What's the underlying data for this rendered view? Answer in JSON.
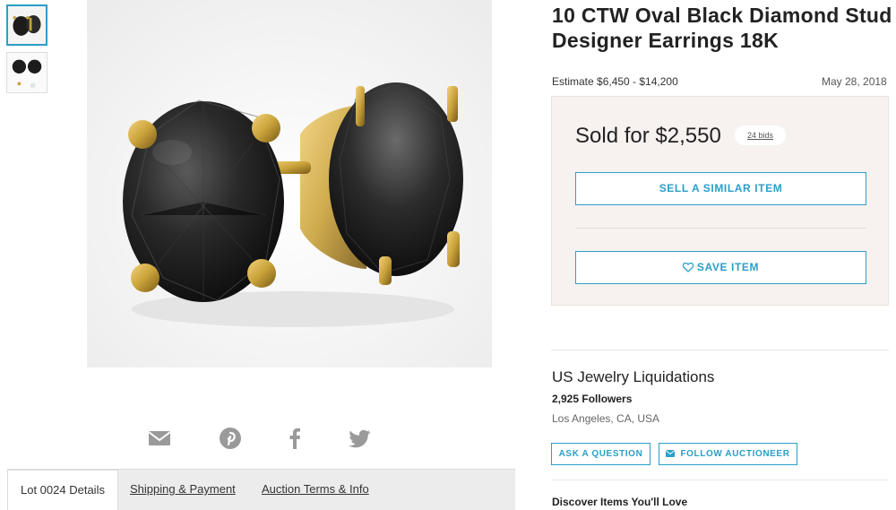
{
  "product": {
    "title": "10 CTW Oval Black Diamond Stud Designer Earrings 18K",
    "estimate": "Estimate $6,450 - $14,200",
    "date": "May 28, 2018"
  },
  "result": {
    "sold_text": "Sold for $2,550",
    "bids": "24 bids",
    "sell_similar_label": "SELL A SIMILAR ITEM",
    "save_label": "SAVE ITEM"
  },
  "seller": {
    "name": "US Jewelry Liquidations",
    "followers": "2,925 Followers",
    "location": "Los Angeles, CA, USA",
    "ask_label": "ASK A QUESTION",
    "follow_label": "FOLLOW AUCTIONEER"
  },
  "discover": "Discover Items You'll Love",
  "tabs": [
    {
      "label": "Lot 0024 Details"
    },
    {
      "label": "Shipping & Payment"
    },
    {
      "label": "Auction Terms & Info"
    }
  ],
  "share_icons": [
    "email-icon",
    "pinterest-icon",
    "facebook-icon",
    "twitter-icon"
  ],
  "colors": {
    "accent": "#2a9fc7",
    "sold_box_bg": "#f7f2ef",
    "gold": "#c9a23a",
    "stone": "#1c1c1c"
  }
}
